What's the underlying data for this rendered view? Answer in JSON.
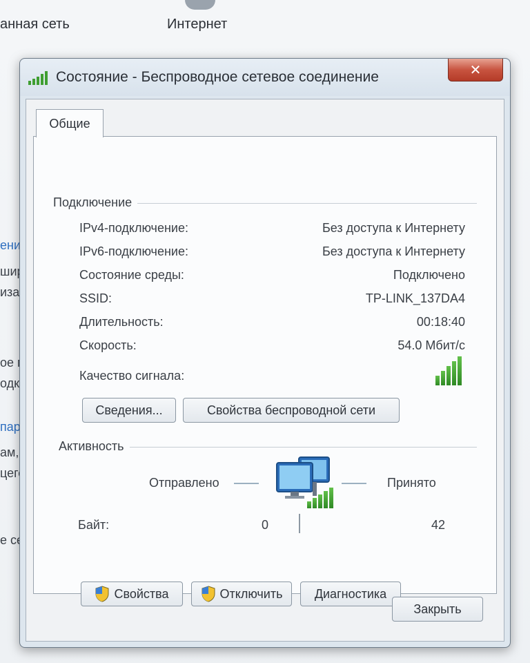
{
  "background": {
    "top_labels": [
      "анная сеть",
      "Интернет"
    ],
    "left_fragments": [
      "ени",
      "шир",
      "иза",
      "ое п",
      "одк",
      "пар",
      "ам,",
      "цего",
      "е сет"
    ]
  },
  "dialog": {
    "title": "Состояние - Беспроводное сетевое соединение",
    "close_glyph": "✕",
    "tab_label": "Общие",
    "connection": {
      "group_label": "Подключение",
      "rows": [
        {
          "label": "IPv4-подключение:",
          "value": "Без доступа к Интернету"
        },
        {
          "label": "IPv6-подключение:",
          "value": "Без доступа к Интернету"
        },
        {
          "label": "Состояние среды:",
          "value": "Подключено"
        },
        {
          "label": "SSID:",
          "value": "TP-LINK_137DA4"
        },
        {
          "label": "Длительность:",
          "value": "00:18:40"
        },
        {
          "label": "Скорость:",
          "value": "54.0 Мбит/с"
        }
      ],
      "signal_label": "Качество сигнала:",
      "signal_level": 5,
      "signal_max": 5
    },
    "buttons_top": {
      "details": "Сведения...",
      "wireless_properties": "Свойства беспроводной сети"
    },
    "activity": {
      "group_label": "Активность",
      "sent_label": "Отправлено",
      "received_label": "Принято",
      "bytes_label": "Байт:",
      "bytes_sent": "0",
      "bytes_received": "42"
    },
    "buttons_bottom": {
      "properties": "Свойства",
      "disable": "Отключить",
      "diagnostics": "Диагностика"
    },
    "close_button": "Закрыть"
  },
  "icons": {
    "title": "wireless-signal-icon",
    "signal": "signal-strength-icon",
    "activity": "network-computers-icon",
    "shield": "uac-shield-icon"
  },
  "colors": {
    "signal_green": "#3f9e31",
    "close_red": "#c85440",
    "link_blue": "#2e6fc0"
  }
}
